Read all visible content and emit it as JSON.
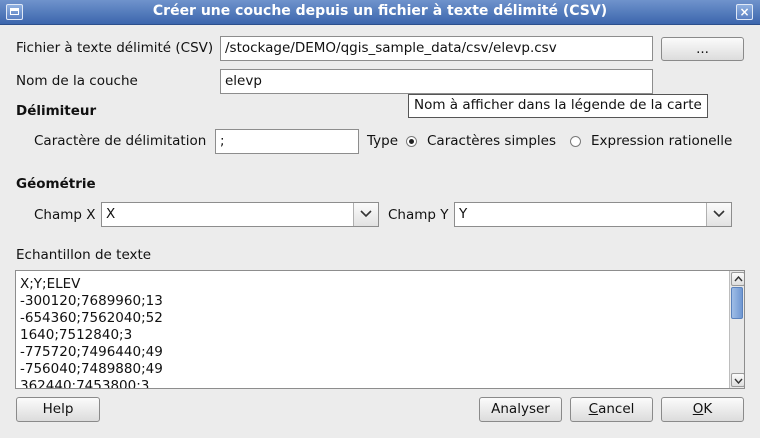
{
  "window": {
    "title": "Créer une couche depuis un fichier à texte délimité (CSV)",
    "close_glyph": "×"
  },
  "file": {
    "label": "Fichier à texte délimité (CSV)",
    "value": "/stockage/DEMO/qgis_sample_data/csv/elevp.csv",
    "browse_label": "..."
  },
  "layer": {
    "label": "Nom de la couche",
    "value": "elevp",
    "tooltip": "Nom à afficher dans la légende de la carte"
  },
  "delimiter": {
    "heading": "Délimiteur",
    "char_label": "Caractère de délimitation",
    "char_value": ";",
    "type_label": "Type",
    "option_simple": "Caractères simples",
    "option_regex": "Expression rationelle",
    "selected": "simple"
  },
  "geometry": {
    "heading": "Géométrie",
    "x_label": "Champ X",
    "x_value": "X",
    "y_label": "Champ Y",
    "y_value": "Y"
  },
  "sample": {
    "label": "Echantillon de texte",
    "lines": [
      "X;Y;ELEV",
      "-300120;7689960;13",
      "-654360;7562040;52",
      "1640;7512840;3",
      "-775720;7496440;49",
      "-756040;7489880;49",
      "362440;7453800;3"
    ]
  },
  "buttons": {
    "help": "Help",
    "analyse": "Analyser",
    "cancel_first": "C",
    "cancel_rest": "ancel",
    "ok_first": "O",
    "ok_rest": "K"
  }
}
